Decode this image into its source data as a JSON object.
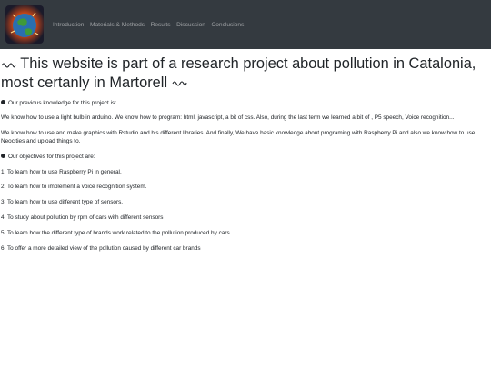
{
  "nav": {
    "items": [
      "Introduction",
      "Materials & Methods",
      "Results",
      "Discussion",
      "Conclusions"
    ]
  },
  "heading": {
    "line1": "This website is part of a research project about pollution in Catalonia,",
    "line2": "most certanly in Martorell"
  },
  "previous": {
    "title": "Our previous knowledge for this project is:",
    "para1": "We know how to use a light bulb in arduino. We know how to program: html, javascript, a bit of css. Also, during the last term we learned a bit of , P5 speech, Voice recognition...",
    "para2": "We know how to use and make graphics with Rstudio and his different libraries. And finally, We have basic knowledge about programing with Raspberry Pi and also we know how to use Neocities and upload things to."
  },
  "objectives": {
    "title": "Our objectives for this project are:",
    "items": [
      "1. To learn how to use Raspberry Pi in general.",
      "2. To learn how to implement a voice recognition system.",
      "3. To learn how to use different type of sensors.",
      "4. To study about pollution by rpm of cars with different sensors",
      "5. To learn how the different type of brands work related to the pollution produced by cars.",
      "6. To offer a more detailed view of the pollution caused by different car brands"
    ]
  },
  "colors": {
    "navbar_bg": "#343a40",
    "nav_text": "rgba(255,255,255,0.5)",
    "body_text": "#212529"
  }
}
